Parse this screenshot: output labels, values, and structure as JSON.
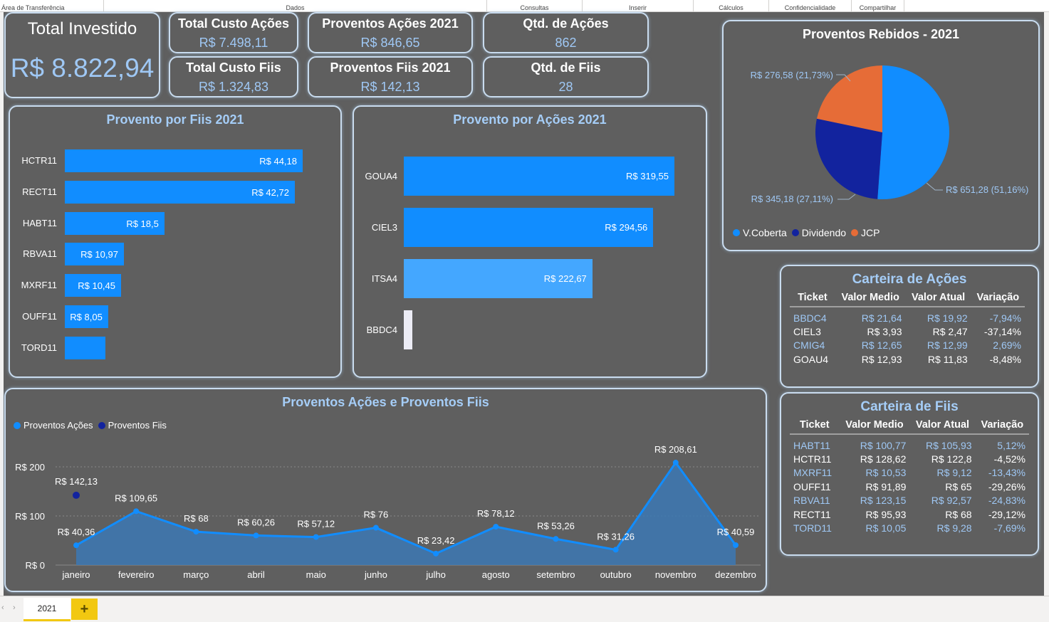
{
  "ribbon": {
    "groups": [
      "Área de Transferência",
      "Dados",
      "Consultas",
      "Inserir",
      "Cálculos",
      "Confidencialidade",
      "Compartilhar"
    ]
  },
  "kpis": {
    "total_investido": {
      "title": "Total Investido",
      "value": "R$ 8.822,94"
    },
    "total_custo_acoes": {
      "title": "Total Custo Ações",
      "value": "R$ 7.498,11"
    },
    "total_custo_fiis": {
      "title": "Total Custo Fiis",
      "value": "R$ 1.324,83"
    },
    "proventos_acoes_2021": {
      "title": "Proventos Ações 2021",
      "value": "R$ 846,65"
    },
    "proventos_fiis_2021": {
      "title": "Proventos Fiis 2021",
      "value": "R$ 142,13"
    },
    "qtd_acoes": {
      "title": "Qtd. de Ações",
      "value": "862"
    },
    "qtd_fiis": {
      "title": "Qtd. de Fiis",
      "value": "28"
    }
  },
  "chart_data": [
    {
      "type": "bar",
      "title": "Provento por Fiis 2021",
      "orientation": "horizontal",
      "categories": [
        "HCTR11",
        "RECT11",
        "HABT11",
        "RBVA11",
        "MXRF11",
        "OUFF11",
        "TORD11"
      ],
      "values": [
        44.18,
        42.72,
        18.5,
        10.97,
        10.45,
        8.05,
        7.5
      ],
      "labels": [
        "R$ 44,18",
        "R$ 42,72",
        "R$ 18,5",
        "R$ 10,97",
        "R$ 10,45",
        "R$ 8,05",
        ""
      ],
      "bar_color": "#118dff"
    },
    {
      "type": "bar",
      "title": "Provento por Ações 2021",
      "orientation": "horizontal",
      "categories": [
        "GOUA4",
        "CIEL3",
        "ITSA4",
        "BBDC4"
      ],
      "values": [
        319.55,
        294.56,
        222.67,
        9.87
      ],
      "labels": [
        "R$ 319,55",
        "R$ 294,56",
        "R$ 222,67",
        ""
      ],
      "bar_colors": [
        "#118dff",
        "#118dff",
        "#44a7ff",
        "#ececf5"
      ]
    },
    {
      "type": "pie",
      "title": "Proventos Rebidos - 2021",
      "series": [
        {
          "name": "V.Coberta",
          "value": 651.28,
          "label": "R$ 651,28 (51,16%)",
          "color": "#118dff"
        },
        {
          "name": "Dividendo",
          "value": 345.18,
          "label": "R$ 345,18 (27,11%)",
          "color": "#12239e"
        },
        {
          "name": "JCP",
          "value": 276.58,
          "label": "R$ 276,58 (21,73%)",
          "color": "#e66c37"
        }
      ],
      "legend_position": "bottom-left"
    },
    {
      "type": "area",
      "title": "Proventos Ações e Proventos Fiis",
      "categories": [
        "janeiro",
        "fevereiro",
        "março",
        "abril",
        "maio",
        "junho",
        "julho",
        "agosto",
        "setembro",
        "outubro",
        "novembro",
        "dezembro"
      ],
      "series": [
        {
          "name": "Proventos Ações",
          "color": "#118dff",
          "values": [
            40.36,
            109.65,
            68,
            60.26,
            57.12,
            76,
            23.42,
            78.12,
            53.26,
            31.26,
            208.61,
            40.59
          ],
          "labels": [
            "R$ 40,36",
            "R$ 109,65",
            "R$ 68",
            "R$ 60,26",
            "R$ 57,12",
            "R$ 76",
            "R$ 23,42",
            "R$ 78,12",
            "R$ 53,26",
            "R$ 31,26",
            "R$ 208,61",
            "R$ 40,59"
          ]
        },
        {
          "name": "Proventos Fiis",
          "color": "#12239e",
          "values": [
            142.13,
            null,
            null,
            null,
            null,
            null,
            null,
            null,
            null,
            null,
            null,
            null
          ],
          "labels": [
            "R$ 142,13",
            "",
            "",
            "",
            "",
            "",
            "",
            "",
            "",
            "",
            "",
            ""
          ]
        }
      ],
      "y_ticks": [
        "R$ 0",
        "R$ 100",
        "R$ 200"
      ],
      "ylim": [
        0,
        220
      ],
      "grid": "dotted",
      "legend_position": "top-left"
    }
  ],
  "carteira_acoes": {
    "title": "Carteira de Ações",
    "headers": [
      "Ticket",
      "Valor Medio",
      "Valor Atual",
      "Variação"
    ],
    "rows": [
      [
        "BBDC4",
        "R$ 21,64",
        "R$ 19,92",
        "-7,94%"
      ],
      [
        "CIEL3",
        "R$ 3,93",
        "R$ 2,47",
        "-37,14%"
      ],
      [
        "CMIG4",
        "R$ 12,65",
        "R$ 12,99",
        "2,69%"
      ],
      [
        "GOAU4",
        "R$ 12,93",
        "R$ 11,83",
        "-8,48%"
      ]
    ]
  },
  "carteira_fiis": {
    "title": "Carteira de Fiis",
    "headers": [
      "Ticket",
      "Valor Medio",
      "Valor Atual",
      "Variação"
    ],
    "rows": [
      [
        "HABT11",
        "R$ 100,77",
        "R$ 105,93",
        "5,12%"
      ],
      [
        "HCTR11",
        "R$ 128,62",
        "R$ 122,8",
        "-4,52%"
      ],
      [
        "MXRF11",
        "R$ 10,53",
        "R$ 9,12",
        "-13,43%"
      ],
      [
        "OUFF11",
        "R$ 91,89",
        "R$ 65",
        "-29,26%"
      ],
      [
        "RBVA11",
        "R$ 123,15",
        "R$ 92,57",
        "-24,83%"
      ],
      [
        "RECT11",
        "R$ 95,93",
        "R$ 68",
        "-29,12%"
      ],
      [
        "TORD11",
        "R$ 10,05",
        "R$ 9,28",
        "-7,69%"
      ]
    ]
  },
  "tabs": {
    "page": "2021",
    "add_label": "+"
  },
  "nav": {
    "prev": "‹",
    "next": "›"
  }
}
